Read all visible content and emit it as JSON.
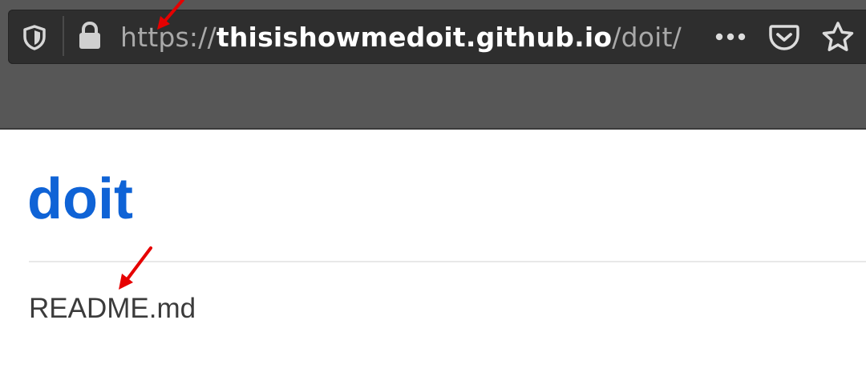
{
  "browser": {
    "url_scheme": "https://",
    "url_host": "thisishowmedoit.github.io",
    "url_path": "/doit/",
    "icons": [
      "shield-icon",
      "lock-icon",
      "more-icon",
      "pocket-icon",
      "star-icon"
    ]
  },
  "page": {
    "title": "doit",
    "file_link": "README.md"
  },
  "colors": {
    "toolbar": "#575757",
    "urlbar": "#2e2e2e",
    "title": "#0f63d6",
    "annotation_arrow": "#e60000"
  }
}
